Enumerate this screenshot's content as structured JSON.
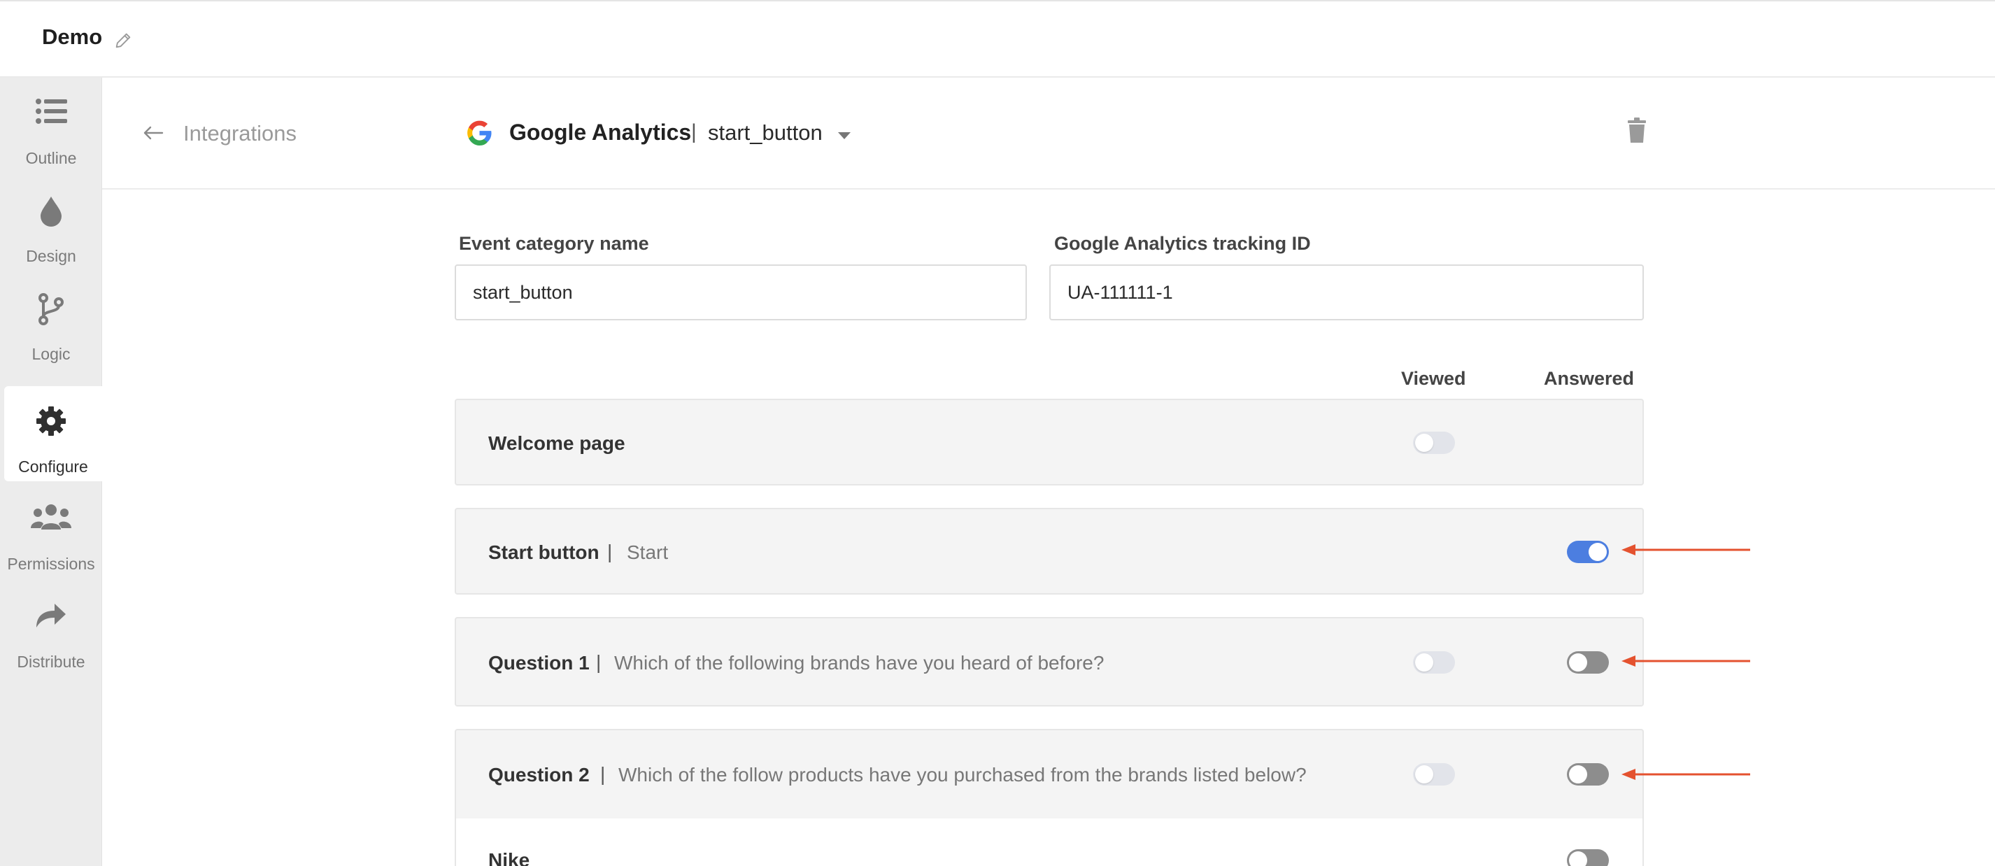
{
  "topbar": {
    "title": "Demo",
    "edit_icon": "pencil-icon"
  },
  "sidebar": {
    "items": [
      {
        "label": "Outline",
        "icon": "list-icon",
        "active": false
      },
      {
        "label": "Design",
        "icon": "droplet-icon",
        "active": false
      },
      {
        "label": "Logic",
        "icon": "branch-icon",
        "active": false
      },
      {
        "label": "Configure",
        "icon": "gear-icon",
        "active": true
      },
      {
        "label": "Permissions",
        "icon": "users-icon",
        "active": false
      },
      {
        "label": "Distribute",
        "icon": "share-arrow-icon",
        "active": false
      }
    ]
  },
  "header": {
    "back_label": "Integrations",
    "integration_name": "Google Analytics",
    "separator": "|",
    "event_name": "start_button",
    "logo": "google-logo-icon",
    "delete_icon": "trash-icon"
  },
  "form": {
    "category_label": "Event category name",
    "category_value": "start_button",
    "tracking_label": "Google Analytics tracking ID",
    "tracking_value": "UA-111111-1"
  },
  "columns": {
    "viewed": "Viewed",
    "answered": "Answered"
  },
  "rows": [
    {
      "title": "Welcome page",
      "sep": "",
      "desc": "",
      "viewed": "disabled",
      "answered": "none"
    },
    {
      "title": "Start button",
      "sep": "|",
      "desc": "Start",
      "viewed": "none",
      "answered": "on"
    },
    {
      "title": "Question 1",
      "sep": "|",
      "desc": "Which of the following brands have you heard of before?",
      "viewed": "disabled",
      "answered": "off"
    },
    {
      "title": "Question 2",
      "sep": "|",
      "desc": "Which of the follow products have you purchased from the brands listed below?",
      "viewed": "disabled",
      "answered": "off"
    },
    {
      "title": "Nike",
      "sep": "",
      "desc": "",
      "viewed": "none",
      "answered": "off"
    }
  ],
  "colors": {
    "toggle_on": "#4c7ee0",
    "toggle_off": "#8d8d8d",
    "toggle_disabled": "#e2e4ea",
    "callout_arrow": "#e4522f"
  }
}
